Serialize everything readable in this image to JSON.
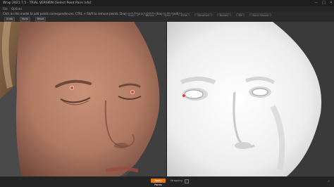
{
  "window": {
    "title": "Wrap 2021.7.5 - TRIAL VERSION [Select Point Pairs Info]",
    "controls": [
      "—",
      "□",
      "✕"
    ]
  },
  "menu": [
    "File",
    "Options"
  ],
  "hint": "Click on the model to add points correspondences. CTRL + Shift to remove points. Drag and drop a point to change its position.",
  "toolbar": {
    "buttons": [
      "Undo",
      "Redo",
      "Reset"
    ]
  },
  "top_controls": [
    "Sync",
    "Mirror",
    "Solo",
    "Grid",
    "Shading",
    "Points",
    "Fit",
    "Sync Views"
  ],
  "bottombar": {
    "apply_label": "Apply Points",
    "wrap_label": "Wrapping",
    "zoom_icon": "search-icon"
  },
  "colors": {
    "accent": "#e07a16",
    "marker": "#c84a3a"
  }
}
